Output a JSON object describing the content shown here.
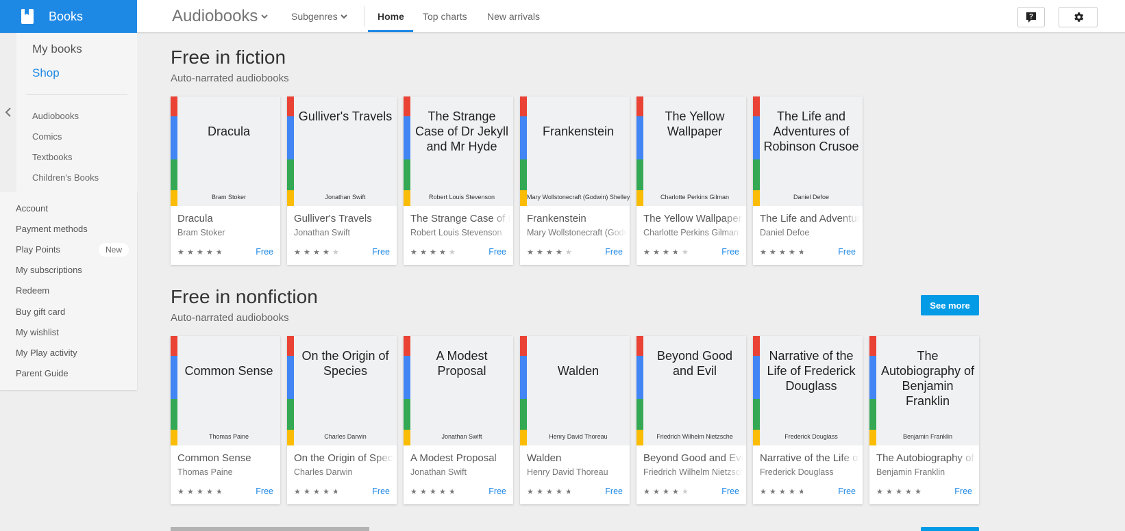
{
  "header": {
    "app_name": "Books",
    "section": "Audiobooks",
    "subgenres_label": "Subgenres",
    "tabs": [
      {
        "label": "Home",
        "active": true
      },
      {
        "label": "Top charts",
        "active": false
      },
      {
        "label": "New arrivals",
        "active": false
      }
    ],
    "help_icon": "help-icon",
    "settings_icon": "gear-icon"
  },
  "sidebar": {
    "primary": [
      {
        "label": "My books",
        "active": false
      },
      {
        "label": "Shop",
        "active": true
      }
    ],
    "categories": [
      "Audiobooks",
      "Comics",
      "Textbooks",
      "Children's Books"
    ],
    "account_links": [
      "Account",
      "Payment methods",
      "Play Points",
      "My subscriptions",
      "Redeem",
      "Buy gift card",
      "My wishlist",
      "My Play activity",
      "Parent Guide"
    ],
    "new_badge": "New"
  },
  "colors": {
    "brand": "#1e88e5",
    "see_more": "#039be5",
    "stripe_red": "#ea4335",
    "stripe_blue": "#4285f4",
    "stripe_green": "#34a853",
    "stripe_yellow": "#fbbc05"
  },
  "rows": [
    {
      "title": "Free in fiction",
      "subtitle": "Auto-narrated audiobooks",
      "see_more": null,
      "books": [
        {
          "cover_title": "Dracula",
          "cover_author": "Bram Stoker",
          "title": "Dracula",
          "author": "Bram Stoker",
          "rating": 4.5,
          "price": "Free"
        },
        {
          "cover_title": "Gulliver's Travels",
          "cover_author": "Jonathan Swift",
          "title": "Gulliver's Travels",
          "author": "Jonathan Swift",
          "rating": 4,
          "price": "Free"
        },
        {
          "cover_title": "The Strange Case of Dr Jekyll and Mr Hyde",
          "cover_author": "Robert Louis Stevenson",
          "title": "The Strange Case of Dr Jekyll and Mr Hyde",
          "author": "Robert Louis Stevenson",
          "rating": 4,
          "price": "Free"
        },
        {
          "cover_title": "Frankenstein",
          "cover_author": "Mary Wollstonecraft (Godwin) Shelley",
          "title": "Frankenstein",
          "author": "Mary Wollstonecraft (Godwin) Shelley",
          "rating": 4,
          "price": "Free"
        },
        {
          "cover_title": "The Yellow Wallpaper",
          "cover_author": "Charlotte Perkins Gilman",
          "title": "The Yellow Wallpaper",
          "author": "Charlotte Perkins Gilman",
          "rating": 3.5,
          "price": "Free"
        },
        {
          "cover_title": "The Life and Adventures of Robinson Crusoe",
          "cover_author": "Daniel Defoe",
          "title": "The Life and Adventures of Robinson Crusoe",
          "author": "Daniel Defoe",
          "rating": 4.5,
          "price": "Free"
        }
      ]
    },
    {
      "title": "Free in nonfiction",
      "subtitle": "Auto-narrated audiobooks",
      "see_more": "See more",
      "books": [
        {
          "cover_title": "Common Sense",
          "cover_author": "Thomas Paine",
          "title": "Common Sense",
          "author": "Thomas Paine",
          "rating": 4.5,
          "price": "Free"
        },
        {
          "cover_title": "On the Origin of Species",
          "cover_author": "Charles Darwin",
          "title": "On the Origin of Species",
          "author": "Charles Darwin",
          "rating": 4.5,
          "price": "Free"
        },
        {
          "cover_title": "A Modest Proposal",
          "cover_author": "Jonathan Swift",
          "title": "A Modest Proposal",
          "author": "Jonathan Swift",
          "rating": 4.5,
          "price": "Free"
        },
        {
          "cover_title": "Walden",
          "cover_author": "Henry David Thoreau",
          "title": "Walden",
          "author": "Henry David Thoreau",
          "rating": 4.5,
          "price": "Free"
        },
        {
          "cover_title": "Beyond Good and Evil",
          "cover_author": "Friedrich Wilhelm Nietzsche",
          "title": "Beyond Good and Evil",
          "author": "Friedrich Wilhelm Nietzsche",
          "rating": 4,
          "price": "Free"
        },
        {
          "cover_title": "Narrative of the Life of Frederick Douglass",
          "cover_author": "Frederick Douglass",
          "title": "Narrative of the Life of Frederick Douglass",
          "author": "Frederick Douglass",
          "rating": 4.5,
          "price": "Free"
        },
        {
          "cover_title": "The Autobiography of Benjamin Franklin",
          "cover_author": "Benjamin Franklin",
          "title": "The Autobiography of Benjamin Franklin",
          "author": "Benjamin Franklin",
          "rating": 5,
          "price": "Free"
        }
      ]
    }
  ]
}
